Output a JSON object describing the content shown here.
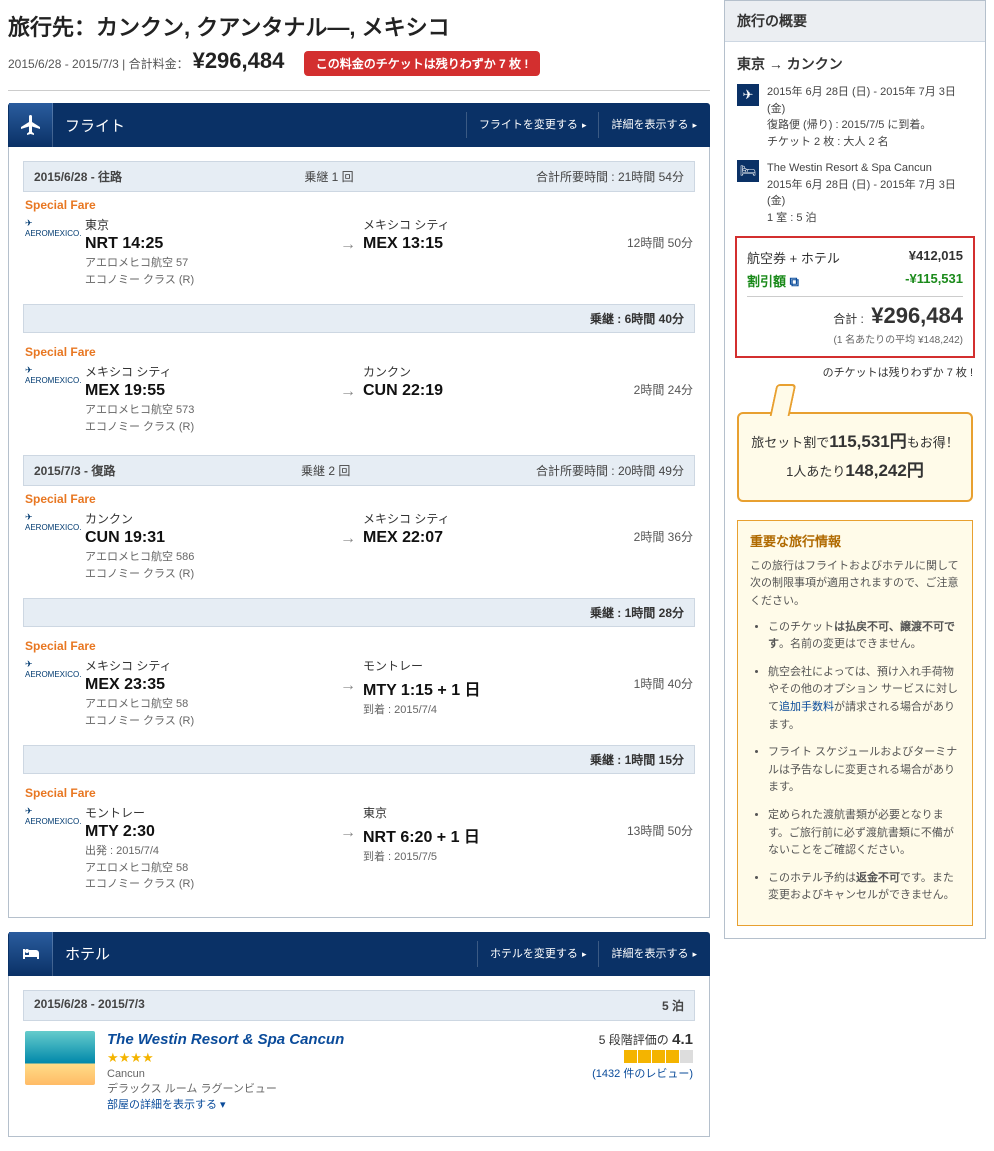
{
  "header": {
    "prefix": "旅行先：",
    "destination": "カンクン, クアンタナル―, メキシコ",
    "dates": "2015/6/28 - 2015/7/3",
    "total_label": "合計料金：",
    "total_price": "¥296,484",
    "warn": "この料金のチケットは残りわずか 7 枚 !"
  },
  "flight": {
    "title": "フライト",
    "change": "フライトを変更する",
    "detail": "詳細を表示する",
    "out": {
      "hdr_date": "2015/6/28 - 往路",
      "hdr_mid": "乗継 1 回",
      "hdr_right": "合計所要時間 : 21時間 54分"
    },
    "ret": {
      "hdr_date": "2015/7/3 - 復路",
      "hdr_mid": "乗継 2 回",
      "hdr_right": "合計所要時間 : 20時間 49分"
    },
    "special": "Special Fare",
    "airline_brand": "AEROMEXICO.",
    "seg1": {
      "from_city": "東京",
      "from_code": "NRT 14:25",
      "to_city": "メキシコ シティ",
      "to_code": "MEX 13:15",
      "dur": "12時間 50分",
      "meta1": "アエロメヒコ航空 57",
      "meta2": "エコノミー クラス (R)"
    },
    "lay1": "乗継 : 6時間 40分",
    "seg2": {
      "from_city": "メキシコ シティ",
      "from_code": "MEX 19:55",
      "to_city": "カンクン",
      "to_code": "CUN 22:19",
      "dur": "2時間 24分",
      "meta1": "アエロメヒコ航空 573",
      "meta2": "エコノミー クラス (R)"
    },
    "seg3": {
      "from_city": "カンクン",
      "from_code": "CUN 19:31",
      "to_city": "メキシコ シティ",
      "to_code": "MEX 22:07",
      "dur": "2時間 36分",
      "meta1": "アエロメヒコ航空 586",
      "meta2": "エコノミー クラス (R)"
    },
    "lay2": "乗継 : 1時間 28分",
    "seg4": {
      "from_city": "メキシコ シティ",
      "from_code": "MEX 23:35",
      "to_city": "モントレー",
      "to_code": "MTY 1:15 + 1 日",
      "to_arr": "到着 : 2015/7/4",
      "dur": "1時間 40分",
      "meta1": "アエロメヒコ航空 58",
      "meta2": "エコノミー クラス (R)"
    },
    "lay3": "乗継 : 1時間 15分",
    "seg5": {
      "from_city": "モントレー",
      "from_code": "MTY 2:30",
      "from_dep": "出発 : 2015/7/4",
      "to_city": "東京",
      "to_code": "NRT 6:20 + 1 日",
      "to_arr": "到着 : 2015/7/5",
      "dur": "13時間 50分",
      "meta1": "アエロメヒコ航空 58",
      "meta2": "エコノミー クラス (R)"
    }
  },
  "hotel": {
    "title": "ホテル",
    "change": "ホテルを変更する",
    "detail": "詳細を表示する",
    "hdr_date": "2015/6/28 - 2015/7/3",
    "nights": "5 泊",
    "name": "The Westin Resort & Spa Cancun",
    "stars": "★★★★",
    "loc": "Cancun",
    "room": "デラックス ルーム ラグーンビュー",
    "room_link": "部屋の詳細を表示する",
    "rating_label": "5 段階評価の ",
    "rating_val": "4.1",
    "reviews": "(1432 件のレビュー)"
  },
  "summary": {
    "hd": "旅行の概要",
    "route": "東京 → カンクン",
    "flight_line1": "2015年 6月 28日 (日) - 2015年 7月 3日 (金)",
    "flight_line2": "復路便 (帰り) : 2015/7/5 に到着。",
    "flight_line3": "チケット 2 枚 : 大人 2 名",
    "hotel_name": "The Westin Resort & Spa Cancun",
    "hotel_line1": "2015年 6月 28日 (日) - 2015年 7月 3日 (金)",
    "hotel_line2": "1 室 : 5 泊",
    "price": {
      "fh_label": "航空券 + ホテル",
      "fh_val": "¥412,015",
      "disc_label": "割引額",
      "disc_val": "-¥115,531",
      "total_label": "合計 :",
      "total_val": "¥296,484",
      "avg": "(1 名あたりの平均 ¥148,242)",
      "warn": "のチケットは残りわずか 7 枚 !"
    },
    "callout_l1a": "旅セット割で",
    "callout_l1b": "115,531円",
    "callout_l1c": "もお得！",
    "callout_l2a": "1人あたり",
    "callout_l2b": "148,242円",
    "important": {
      "hd": "重要な旅行情報",
      "intro": "この旅行はフライトおよびホテルに関して次の制限事項が適用されますので、ご注意ください。",
      "li1a": "このチケット",
      "li1b": "は払戻不可、譲渡不可です",
      "li1c": "。名前の変更はできません。",
      "li2a": "航空会社によっては、預け入れ手荷物やその他のオプション サービスに対して",
      "li2b": "追加手数料",
      "li2c": "が請求される場合があります。",
      "li3": "フライト スケジュールおよびターミナルは予告なしに変更される場合があります。",
      "li4": "定められた渡航書類が必要となります。ご旅行前に必ず渡航書類に不備がないことをご確認ください。",
      "li5a": "このホテル予約は",
      "li5b": "返金不可",
      "li5c": "です。また変更およびキャンセルができません。"
    }
  }
}
